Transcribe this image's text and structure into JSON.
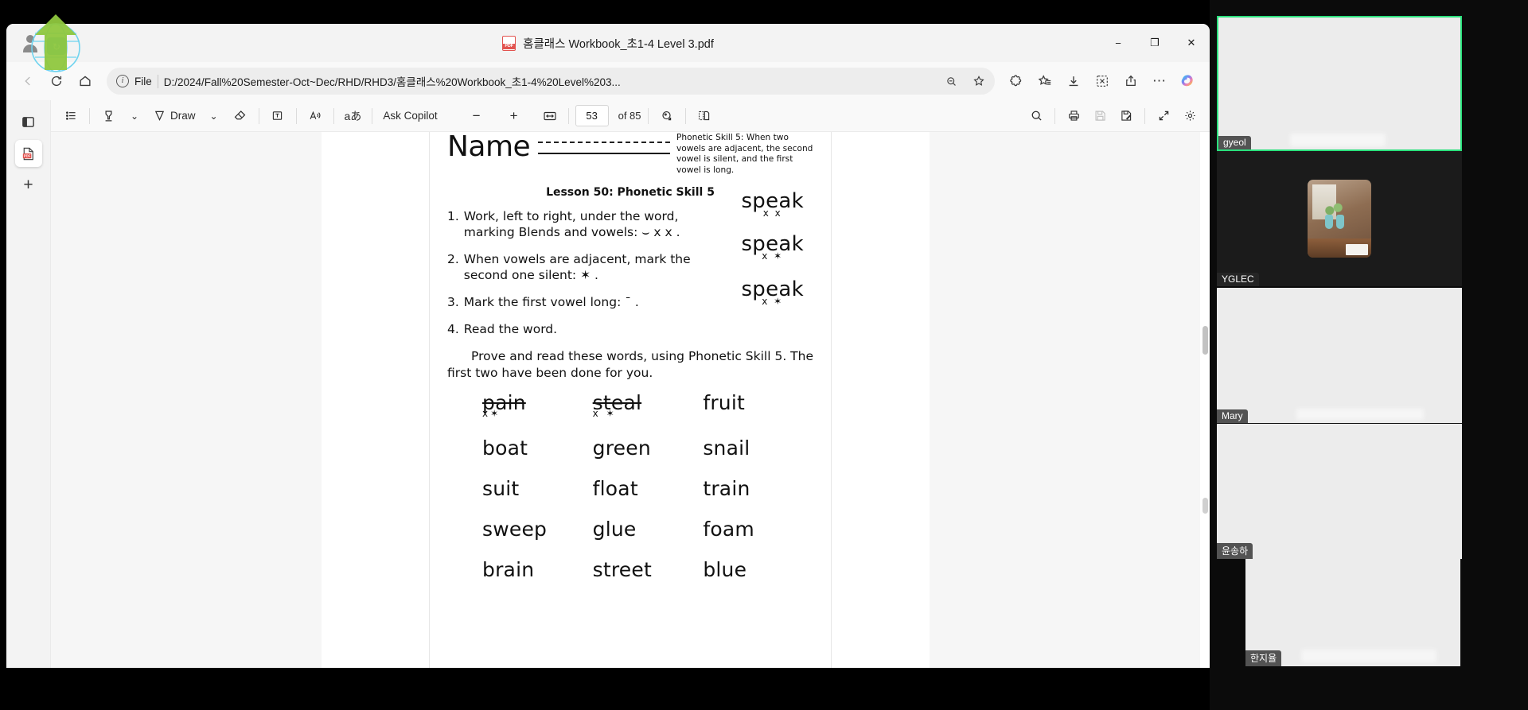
{
  "window": {
    "title": "홈클래스 Workbook_초1-4 Level 3.pdf",
    "minimize_label": "−",
    "maximize_label": "❐",
    "close_label": "✕"
  },
  "navbar": {
    "back_label": "←",
    "refresh_label": "↻",
    "home_label": "⌂",
    "file_chip": "File",
    "url": "D:/2024/Fall%20Semester-Oct~Dec/RHD/RHD3/홈클래스%20Workbook_초1-4%20Level%203...",
    "zoom_out_label": "⊖",
    "favorite_label": "☆",
    "extensions_label": "extensions-icon",
    "collections_label": "collections-icon",
    "downloads_label": "↓",
    "screenshot_label": "screenshot-icon",
    "share_label": "share-icon",
    "more_label": "⋯",
    "copilot_label": "copilot-icon"
  },
  "viewer_sidebar": {
    "toggle_panel": "panel-toggle-icon",
    "pdf_tab": "pdf-tab-icon",
    "add_tab": "+"
  },
  "pdf_toolbar": {
    "toc_label": "table-of-contents-icon",
    "highlight_label": "highlighter-icon",
    "highlight_caret": "⌄",
    "draw_label": "Draw",
    "draw_caret": "⌄",
    "erase_label": "eraser-icon",
    "text_label": "add-text-icon",
    "read_aloud_label": "A",
    "translate_label": "aあ",
    "copilot_label": "Ask Copilot",
    "zoom_out_label": "−",
    "zoom_in_label": "+",
    "fit_width_label": "fit-width-icon",
    "page_number": "53",
    "page_total": "of 85",
    "rotate_label": "rotate-icon",
    "page_view_label": "page-view-icon",
    "search_label": "search-icon",
    "print_label": "print-icon",
    "save_label": "save-icon",
    "save_as_label": "save-as-icon",
    "fullscreen_label": "fullscreen-icon",
    "settings_label": "settings-icon"
  },
  "document": {
    "name_label": "Name",
    "skill_note": "Phonetic Skill 5: When two vowels are adjacent, the second vowel is silent, and the first vowel is long.",
    "lesson_title": "Lesson 50: Phonetic Skill 5",
    "steps": [
      {
        "num": "1.",
        "text": "Work, left to right, under the word, marking Blends and vowels:",
        "mark": "⌣ x x .",
        "sample": "speak",
        "sample_marks": "x x"
      },
      {
        "num": "2.",
        "text": "When vowels are adjacent, mark the second one silent:",
        "mark": "✶ .",
        "sample": "speak",
        "sample_marks": "x ✶"
      },
      {
        "num": "3.",
        "text": "Mark the first vowel long:",
        "mark": "¯ .",
        "sample": "speak",
        "sample_marks": "x ✶"
      },
      {
        "num": "4.",
        "text": "Read the word.",
        "mark": "",
        "sample": "",
        "sample_marks": ""
      }
    ],
    "prove_text_1": "Prove and read these words, using Phonetic Skill 5. The",
    "prove_text_2": "first two have been done for you.",
    "words": [
      "pain",
      "steal",
      "fruit",
      "boat",
      "green",
      "snail",
      "suit",
      "float",
      "train",
      "sweep",
      "glue",
      "foam",
      "brain",
      "street",
      "blue"
    ],
    "marked_words": [
      "pain",
      "steal"
    ],
    "pain_marks": "x✶",
    "steal_marks": "x ✶"
  },
  "video_panel": {
    "participants": [
      {
        "name": "gyeol",
        "active": true,
        "feed": "gray"
      },
      {
        "name": "YGLEC",
        "active": false,
        "feed": "dark-thumb"
      },
      {
        "name": "Mary",
        "active": false,
        "feed": "gray"
      },
      {
        "name": "윤송하",
        "active": false,
        "feed": "gray"
      },
      {
        "name": "한지율",
        "active": false,
        "feed": "gray"
      }
    ]
  },
  "colors": {
    "accent_green": "#2ae07c",
    "pdf_red": "#e2534f",
    "panel_bg": "#0b0b0b"
  }
}
